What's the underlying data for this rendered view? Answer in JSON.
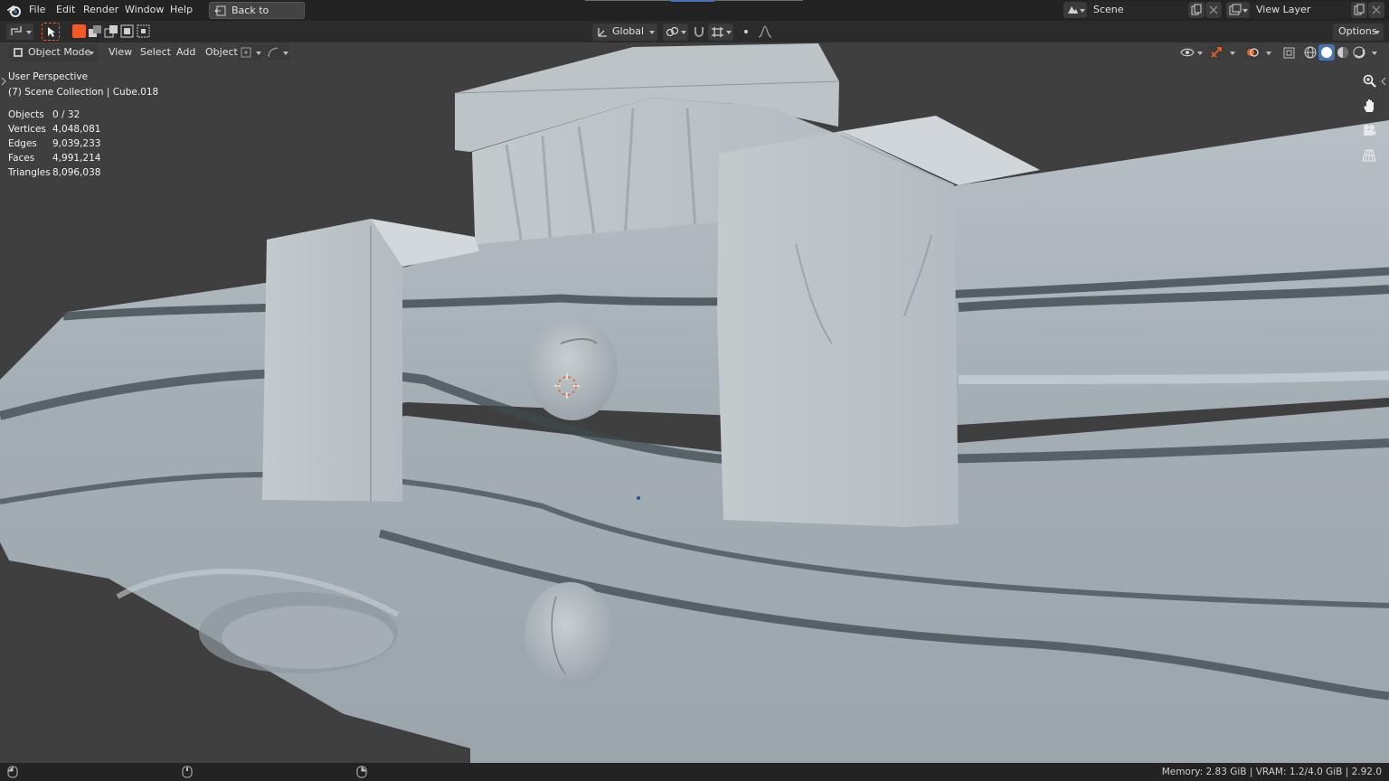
{
  "app": {
    "menus": [
      "File",
      "Edit",
      "Render",
      "Window",
      "Help"
    ],
    "back_button": "Back to Previous"
  },
  "scene": {
    "label": "Scene",
    "view_layer": "View Layer"
  },
  "toolbar": {
    "orientation": "Global",
    "options": "Options"
  },
  "viewport_header": {
    "mode": "Object Mode",
    "menus": [
      "View",
      "Select",
      "Add",
      "Object"
    ]
  },
  "overlay": {
    "perspective": "User Perspective",
    "collection": "(7) Scene Collection | Cube.018",
    "stats": [
      {
        "label": "Objects",
        "value": "0 / 32"
      },
      {
        "label": "Vertices",
        "value": "4,048,081"
      },
      {
        "label": "Edges",
        "value": "9,039,233"
      },
      {
        "label": "Faces",
        "value": "4,991,214"
      },
      {
        "label": "Triangles",
        "value": "8,096,038"
      }
    ]
  },
  "status": {
    "memory": "Memory: 2.83 GiB | VRAM: 1.2/4.0 GiB | 2.92.0"
  },
  "colors": {
    "accent": "#e0612c",
    "active_blue": "#4772b3",
    "model": "#a9b3b9"
  }
}
